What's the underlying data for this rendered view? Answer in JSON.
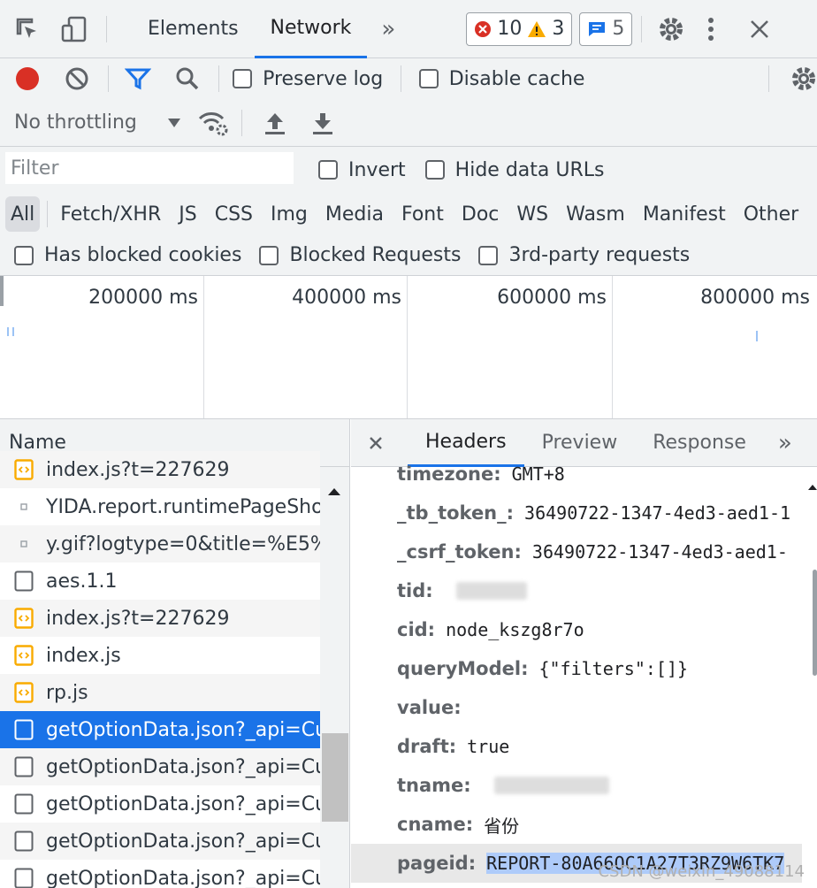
{
  "topbar": {
    "tabs": [
      "Elements",
      "Network"
    ],
    "more": "»",
    "errors": "10",
    "warnings": "3",
    "messages": "5"
  },
  "toolbar1": {
    "preserve_log": "Preserve log",
    "disable_cache": "Disable cache"
  },
  "toolbar2": {
    "throttling": "No throttling"
  },
  "filter": {
    "placeholder": "Filter",
    "invert": "Invert",
    "hide_data_urls": "Hide data URLs"
  },
  "types": [
    "All",
    "Fetch/XHR",
    "JS",
    "CSS",
    "Img",
    "Media",
    "Font",
    "Doc",
    "WS",
    "Wasm",
    "Manifest",
    "Other"
  ],
  "blocked": {
    "has_blocked_cookies": "Has blocked cookies",
    "blocked_requests": "Blocked Requests",
    "third_party": "3rd-party requests"
  },
  "timeline": {
    "labels": [
      "200000 ms",
      "400000 ms",
      "600000 ms",
      "800000 ms"
    ]
  },
  "requests": {
    "header": "Name",
    "items": [
      {
        "name": "index.js?t=227629",
        "icon": "script"
      },
      {
        "name": "YIDA.report.runtimePageSho...",
        "icon": "other"
      },
      {
        "name": "y.gif?logtype=0&title=%E5%8...",
        "icon": "other"
      },
      {
        "name": "aes.1.1",
        "icon": "document"
      },
      {
        "name": "index.js?t=227629",
        "icon": "script"
      },
      {
        "name": "index.js",
        "icon": "script"
      },
      {
        "name": "rp.js",
        "icon": "script"
      },
      {
        "name": "getOptionData.json?_api=Cu...",
        "icon": "document"
      },
      {
        "name": "getOptionData.json?_api=Cu...",
        "icon": "document"
      },
      {
        "name": "getOptionData.json?_api=Cu...",
        "icon": "document"
      },
      {
        "name": "getOptionData.json?_api=Cu...",
        "icon": "document"
      },
      {
        "name": "getOptionData.json?_api=Cu...",
        "icon": "document"
      }
    ]
  },
  "details": {
    "tabs": [
      "Headers",
      "Preview",
      "Response"
    ],
    "more": "»",
    "rows": [
      {
        "key": "timezone:",
        "value": "GMT+8"
      },
      {
        "key": "_tb_token_:",
        "value": "36490722-1347-4ed3-aed1-1"
      },
      {
        "key": "_csrf_token:",
        "value": "36490722-1347-4ed3-aed1-"
      },
      {
        "key": "tid:",
        "value": ""
      },
      {
        "key": "cid:",
        "value": "node_kszg8r7o"
      },
      {
        "key": "queryModel:",
        "value": "{\"filters\":[]}"
      },
      {
        "key": "value:",
        "value": ""
      },
      {
        "key": "draft:",
        "value": "true"
      },
      {
        "key": "tname:",
        "value": ""
      },
      {
        "key": "cname:",
        "value": "省份"
      },
      {
        "key": "pageid:",
        "value": "REPORT-80A66OC1A27T3RZ9W6TK7"
      }
    ]
  },
  "watermark": "CSDN @weixin_49088114"
}
